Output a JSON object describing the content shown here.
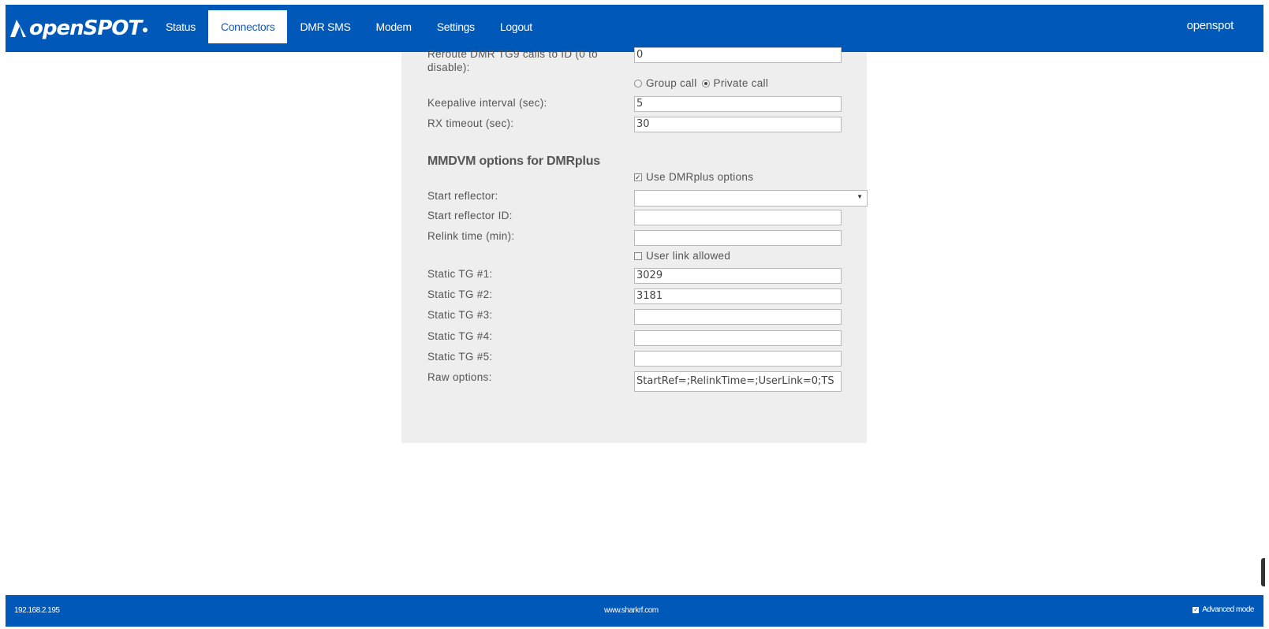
{
  "brand": {
    "name": "openSPOT"
  },
  "nav": {
    "items": [
      {
        "label": "Status"
      },
      {
        "label": "Connectors"
      },
      {
        "label": "DMR SMS"
      },
      {
        "label": "Modem"
      },
      {
        "label": "Settings"
      },
      {
        "label": "Logout"
      }
    ],
    "active": "Connectors",
    "user": "openspot"
  },
  "form": {
    "reroute": {
      "label": "Reroute DMR TG9 calls to ID (0 to disable):",
      "value": "0"
    },
    "call_type": {
      "group_label": "Group call",
      "private_label": "Private call",
      "selected": "Private call"
    },
    "keepalive": {
      "label": "Keepalive interval (sec):",
      "value": "5"
    },
    "rx_timeout": {
      "label": "RX timeout (sec):",
      "value": "30"
    },
    "mmdvm_title": "MMDVM options for DMRplus",
    "use_dmrplus": {
      "label": "Use DMRplus options",
      "checked": true
    },
    "start_reflector": {
      "label": "Start reflector:",
      "value": ""
    },
    "start_reflector_id": {
      "label": "Start reflector ID:",
      "value": ""
    },
    "relink_time": {
      "label": "Relink time (min):",
      "value": ""
    },
    "user_link": {
      "label": "User link allowed",
      "checked": false
    },
    "static_tg1": {
      "label": "Static TG #1:",
      "value": "3029"
    },
    "static_tg2": {
      "label": "Static TG #2:",
      "value": "3181"
    },
    "static_tg3": {
      "label": "Static TG #3:",
      "value": ""
    },
    "static_tg4": {
      "label": "Static TG #4:",
      "value": ""
    },
    "static_tg5": {
      "label": "Static TG #5:",
      "value": ""
    },
    "raw_options": {
      "label": "Raw options:",
      "value": "StartRef=;RelinkTime=;UserLink=0;TS"
    }
  },
  "footer": {
    "ip": "192.168.2.195",
    "site": "www.sharkrf.com",
    "advanced_mode": {
      "label": "Advanced mode",
      "checked": true
    }
  },
  "colors": {
    "bar": "#0058b9",
    "panel": "#eeeeee"
  }
}
